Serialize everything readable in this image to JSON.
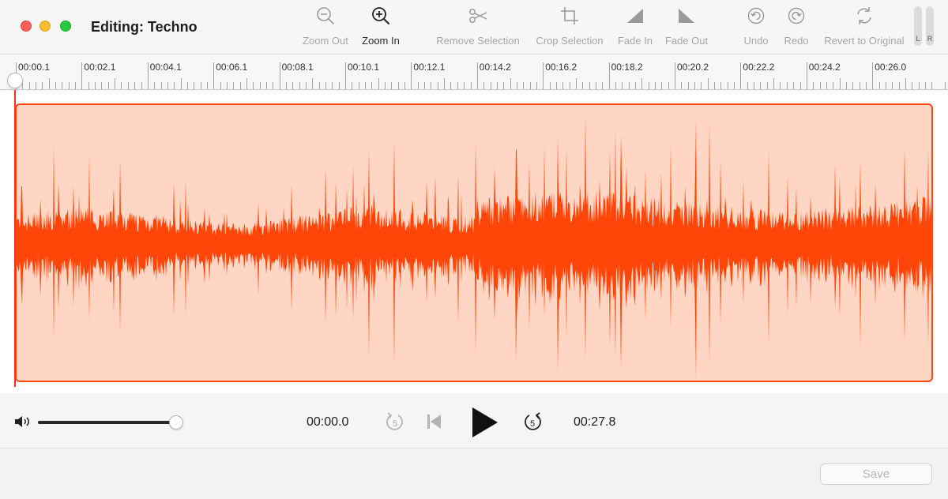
{
  "window": {
    "title": "Editing: Techno"
  },
  "toolbar": {
    "zoom_out": "Zoom Out",
    "zoom_in": "Zoom In",
    "remove_selection": "Remove Selection",
    "crop_selection": "Crop Selection",
    "fade_in": "Fade In",
    "fade_out": "Fade Out",
    "undo": "Undo",
    "redo": "Redo",
    "revert": "Revert to Original",
    "meter_left": "L",
    "meter_right": "R"
  },
  "ruler": {
    "labels": [
      "00:00.1",
      "00:02.1",
      "00:04.1",
      "00:06.1",
      "00:08.1",
      "00:10.1",
      "00:12.1",
      "00:14.2",
      "00:16.2",
      "00:18.2",
      "00:20.2",
      "00:22.2",
      "00:24.2",
      "00:26.0"
    ]
  },
  "waveform": {
    "color": "#ff4508",
    "selection_fill": "#ffd5c4",
    "selection_border": "#ff4a14"
  },
  "playback": {
    "current_time": "00:00.0",
    "duration": "00:27.8",
    "skip_back_seconds": "5",
    "skip_forward_seconds": "5",
    "volume_fraction": 0.97
  },
  "footer": {
    "save_label": "Save"
  }
}
